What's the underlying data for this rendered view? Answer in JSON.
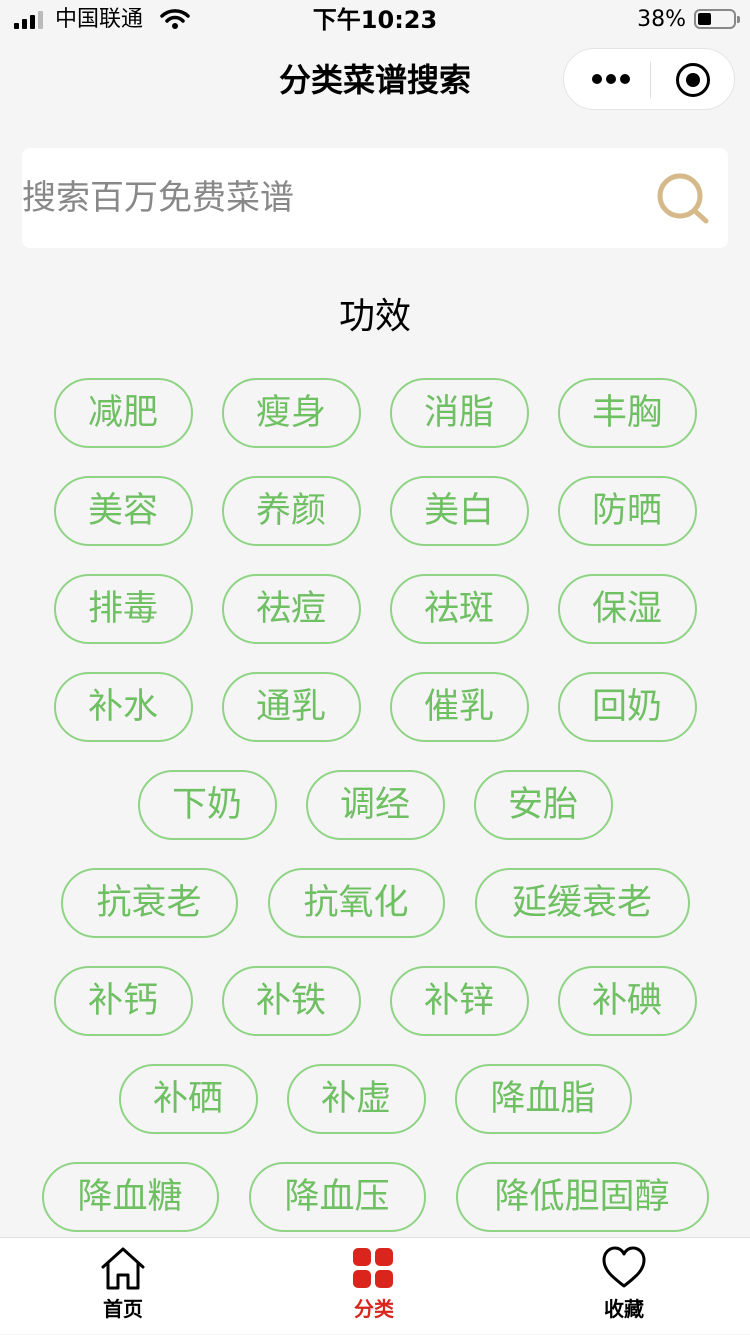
{
  "status_bar": {
    "carrier": "中国联通",
    "time": "下午10:23",
    "battery": "38%"
  },
  "nav": {
    "title": "分类菜谱搜索"
  },
  "search": {
    "placeholder": "搜索百万免费菜谱"
  },
  "section": {
    "title": "功效",
    "rows": [
      [
        "减肥",
        "瘦身",
        "消脂",
        "丰胸"
      ],
      [
        "美容",
        "养颜",
        "美白",
        "防晒"
      ],
      [
        "排毒",
        "祛痘",
        "祛斑",
        "保湿"
      ],
      [
        "补水",
        "通乳",
        "催乳",
        "回奶"
      ],
      [
        "下奶",
        "调经",
        "安胎"
      ],
      [
        "抗衰老",
        "抗氧化",
        "延缓衰老"
      ],
      [
        "补钙",
        "补铁",
        "补锌",
        "补碘"
      ],
      [
        "补硒",
        "补虚",
        "降血脂"
      ],
      [
        "降血糖",
        "降血压",
        "降低胆固醇"
      ]
    ]
  },
  "tab_bar": {
    "items": [
      {
        "label": "首页",
        "icon": "home-icon"
      },
      {
        "label": "分类",
        "icon": "category-grid-icon"
      },
      {
        "label": "收藏",
        "icon": "heart-icon"
      }
    ],
    "active_color": "#d9251c"
  },
  "colors": {
    "tag_border": "#8fd485",
    "tag_text": "#6fbf63",
    "search_icon": "#d6b98a"
  }
}
